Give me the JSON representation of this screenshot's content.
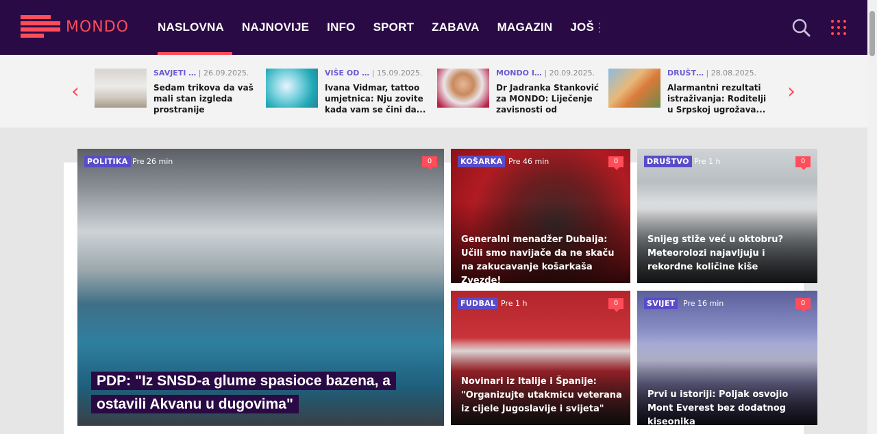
{
  "brand": {
    "logo_text": "MONDO",
    "accent": "#ff4d5a",
    "header_bg": "#2a0a45",
    "badge_color": "#5a4cc8"
  },
  "nav": {
    "items": [
      {
        "label": "NASLOVNA",
        "active": true
      },
      {
        "label": "NAJNOVIJE"
      },
      {
        "label": "INFO"
      },
      {
        "label": "SPORT"
      },
      {
        "label": "ZABAVA"
      },
      {
        "label": "MAGAZIN"
      },
      {
        "label": "JOŠ"
      }
    ],
    "search_icon": "search-icon",
    "apps_icon": "apps-grid-icon"
  },
  "ticker": {
    "prev_label": "‹",
    "next_label": "›",
    "items": [
      {
        "category": "SAVJETI …",
        "date": "26.09.2025.",
        "title": "Sedam trikova da vaš mali stan izgleda prostranije"
      },
      {
        "category": "VIŠE OD …",
        "date": "15.09.2025.",
        "title": "Ivana Vidmar, tattoo umjetnica: Nju zovite kada vam se čini da..."
      },
      {
        "category": "MONDO I…",
        "date": "20.09.2025.",
        "title": "Dr Jadranka Stanković za MONDO: Liječenje zavisnosti od kockan..."
      },
      {
        "category": "DRUŠT…",
        "date": "28.08.2025.",
        "title": "Alarmantni rezultati istraživanja: Roditelji u Srpskoj ugrožava..."
      }
    ]
  },
  "articles": {
    "main": {
      "category": "POLITIKA",
      "time": "Pre 26 min",
      "comments": "0",
      "title": "PDP: \"Iz SNSD-a glume spasioce bazena, a ostavili Akvanu u dugovima\""
    },
    "side": [
      {
        "category": "KOŠARKA",
        "time": "Pre 46 min",
        "comments": "0",
        "title": "Generalni menadžer Dubaija: Učili smo navijače da ne skaču na zakucavanje košarkaša Zvezde!"
      },
      {
        "category": "DRUŠTVO",
        "time": "Pre 1 h",
        "comments": "0",
        "title": "Snijeg stiže već u oktobru? Meteorolozi najavljuju i rekordne količine kiše"
      },
      {
        "category": "FUDBAL",
        "time": "Pre 1 h",
        "comments": "0",
        "title": "Novinari iz Italije i Španije: \"Organizujte utakmicu veterana iz cijele Jugoslavije i svijeta\""
      },
      {
        "category": "SVIJET",
        "time": "Pre 16 min",
        "comments": "0",
        "title": "Prvi u istoriji: Poljak osvojio Mont Everest bez dodatnog kiseonika"
      }
    ]
  }
}
